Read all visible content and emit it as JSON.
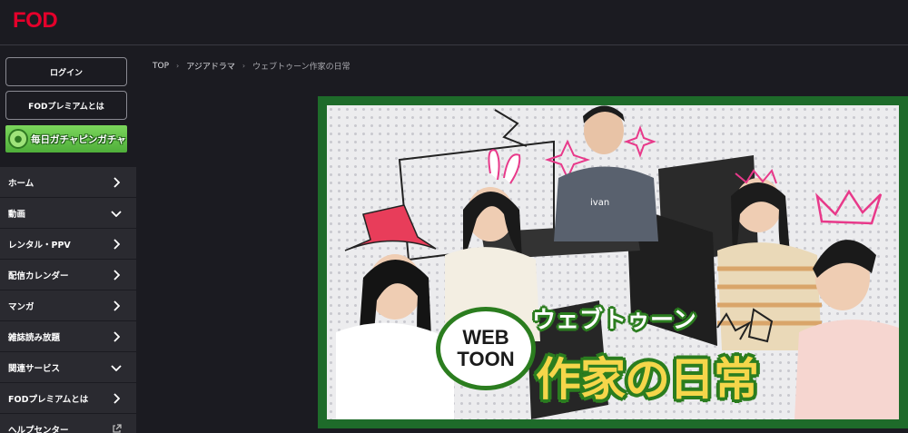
{
  "header": {
    "logo": "FOD"
  },
  "sidebar": {
    "login_label": "ログイン",
    "premium_label": "FODプレミアムとは",
    "banner_text": "毎日ガチャピンガチャ",
    "items": [
      {
        "label": "ホーム",
        "icon": "chevron-right-icon"
      },
      {
        "label": "動画",
        "icon": "chevron-down-icon"
      },
      {
        "label": "レンタル・PPV",
        "icon": "chevron-right-icon"
      },
      {
        "label": "配信カレンダー",
        "icon": "chevron-right-icon"
      },
      {
        "label": "マンガ",
        "icon": "chevron-right-icon"
      },
      {
        "label": "雑誌読み放題",
        "icon": "chevron-right-icon"
      },
      {
        "label": "関連サービス",
        "icon": "chevron-down-icon"
      },
      {
        "label": "FODプレミアムとは",
        "icon": "chevron-right-icon"
      },
      {
        "label": "ヘルプセンター",
        "icon": "external-link-icon"
      }
    ]
  },
  "breadcrumb": {
    "items": [
      "TOP",
      "アジアドラマ",
      "ウェブトゥーン作家の日常"
    ],
    "separator": "›"
  },
  "hero": {
    "badge_line1": "WEB",
    "badge_line2": "TOON",
    "title_sub": "ウェブトゥーン",
    "title_main": "作家の日常",
    "shirt_text": "ivan"
  },
  "colors": {
    "brand": "#e4002b",
    "background": "#1b1b21",
    "nav_item_bg": "#2a2a30",
    "hero_frame": "#1e6b2a",
    "title_yellow": "#f5d64a"
  }
}
